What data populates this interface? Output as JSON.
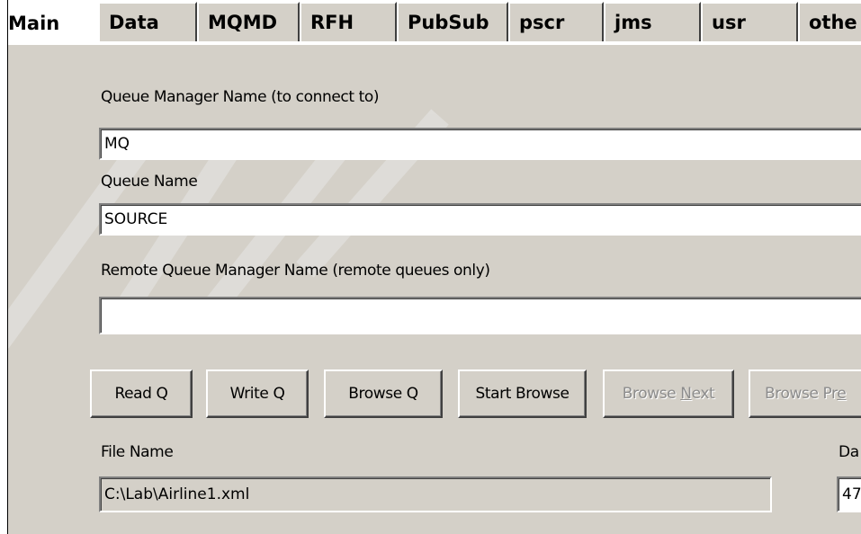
{
  "tabs": [
    {
      "label": "Main",
      "active": true
    },
    {
      "label": "Data"
    },
    {
      "label": "MQMD"
    },
    {
      "label": "RFH"
    },
    {
      "label": "PubSub"
    },
    {
      "label": "pscr"
    },
    {
      "label": "jms"
    },
    {
      "label": "usr"
    },
    {
      "label": "othe"
    }
  ],
  "form": {
    "qmgr_label": "Queue Manager Name (to connect to)",
    "qmgr_value": "MQ",
    "queue_label": "Queue Name",
    "queue_value": "SOURCE",
    "remote_qmgr_label": "Remote Queue Manager Name (remote queues only)",
    "remote_qmgr_value": "",
    "file_label": "File Name",
    "file_value": "C:\\Lab\\Airline1.xml",
    "right_label": "Da",
    "right_value": "47"
  },
  "buttons": {
    "read": "Read Q",
    "write": "Write Q",
    "browse": "Browse Q",
    "start_browse": "Start Browse",
    "browse_next_pre": "Browse ",
    "browse_next_mnemonic": "N",
    "browse_next_post": "ext",
    "browse_prev_pre": "Browse Pr",
    "browse_prev_mnemonic": "e"
  },
  "colors": {
    "face": "#d4d0c8",
    "disabled_text": "#8c8c8c"
  }
}
